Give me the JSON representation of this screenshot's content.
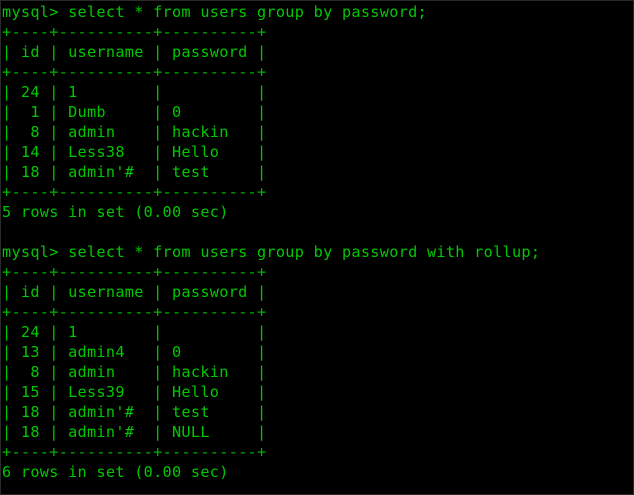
{
  "theme": {
    "background": "#000000",
    "text_color": "#00c800"
  },
  "session": {
    "blocks": [
      {
        "prompt": "mysql> select * from users group by password;",
        "border": "+----+----------+----------+",
        "header": "| id | username | password |",
        "rows": [
          "| 24 | 1        |          |",
          "|  1 | Dumb     | 0        |",
          "|  8 | admin    | hackin   |",
          "| 14 | Less38   | Hello    |",
          "| 18 | admin'#  | test     |"
        ],
        "summary": "5 rows in set (0.00 sec)"
      },
      {
        "prompt": "mysql> select * from users group by password with rollup;",
        "border": "+----+----------+----------+",
        "header": "| id | username | password |",
        "rows": [
          "| 24 | 1        |          |",
          "| 13 | admin4   | 0        |",
          "|  8 | admin    | hackin   |",
          "| 15 | Less39   | Hello    |",
          "| 18 | admin'#  | test     |",
          "| 18 | admin'#  | NULL     |"
        ],
        "summary": "6 rows in set (0.00 sec)"
      }
    ]
  }
}
